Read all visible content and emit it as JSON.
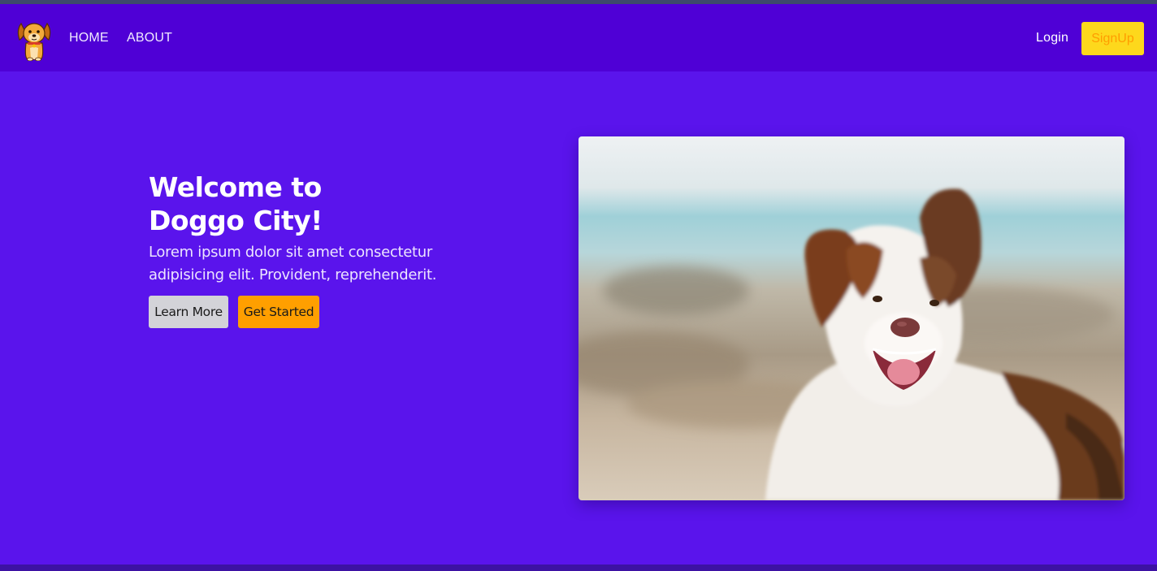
{
  "nav": {
    "logo_icon": "dog-logo-icon",
    "links": [
      {
        "label": "HOME"
      },
      {
        "label": "ABOUT"
      }
    ],
    "login_label": "Login",
    "signup_label": "SignUp"
  },
  "hero": {
    "title_line1": "Welcome to",
    "title_line2": "Doggo City!",
    "text": "Lorem ipsum dolor sit amet consectetur adipisicing elit. Provident, reprehenderit.",
    "learn_more_label": "Learn More",
    "get_started_label": "Get Started",
    "image_icon": "dog-photo"
  },
  "colors": {
    "background": "#5a14ec",
    "navbar": "#4f00d6",
    "signup_bg": "#fdd81c",
    "signup_text": "#ff9d00",
    "get_started_bg": "#ff9f00",
    "learn_more_bg": "#d3d3d8"
  }
}
